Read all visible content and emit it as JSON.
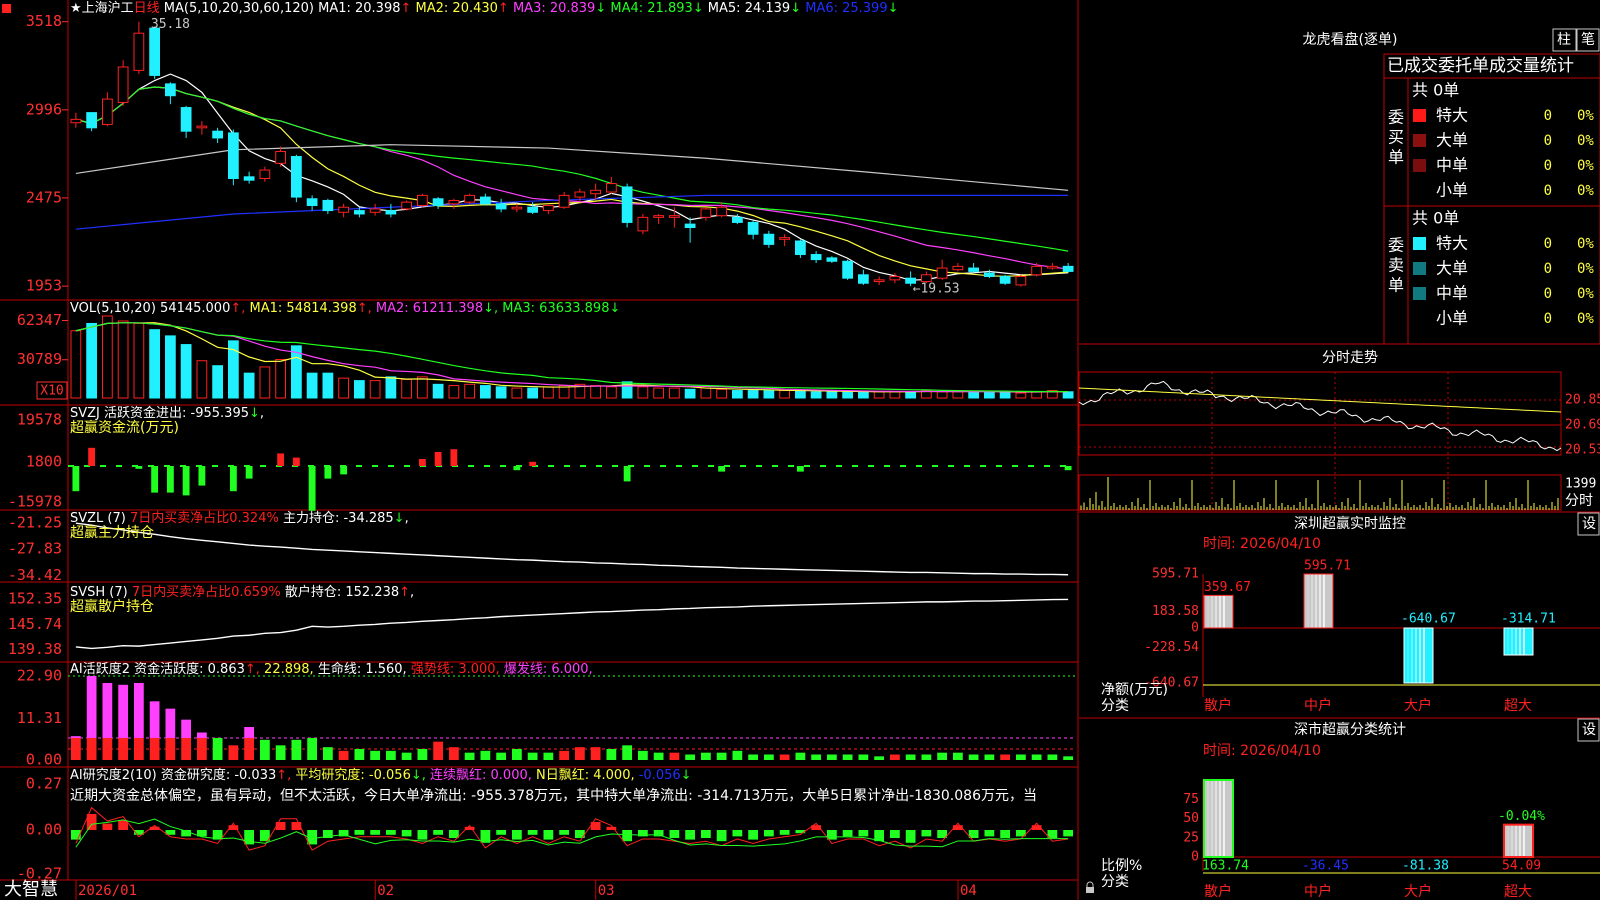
{
  "colors": {
    "up": "#ff2020",
    "down": "#20f0ff",
    "border": "#c00000",
    "yellow": "#ffff40",
    "magenta": "#ff40ff",
    "green": "#20ff20",
    "white": "#ffffff",
    "gray": "#c8c8c8",
    "blue": "#2030ff",
    "axisRed": "#ff3030"
  },
  "chart_header": {
    "menu_icon": "square-menu-icon",
    "title": "★上海沪工",
    "period": "日线",
    "ma_label": "MA(5,10,20,30,60,120)",
    "ma1": "MA1: 20.398",
    "ma1_arrow": "↑",
    "ma2": "MA2: 20.430",
    "ma2_arrow": "↑",
    "ma3": "MA3: 20.839",
    "ma3_arrow": "↓",
    "ma4": "MA4: 21.893",
    "ma4_arrow": "↓",
    "ma5": "MA5: 24.139",
    "ma5_arrow": "↓",
    "ma6": "MA6: 25.399",
    "ma6_arrow": "↓"
  },
  "price_panel": {
    "y_ticks": [
      "3518",
      "2996",
      "2475",
      "1953"
    ],
    "high_label": "35.18",
    "low_label": "←19.53",
    "candles": [
      [
        29.2,
        29.8,
        28.9,
        29.4
      ],
      [
        29.8,
        29.6,
        28.7,
        28.9
      ],
      [
        29.1,
        31.0,
        29.0,
        30.6
      ],
      [
        30.4,
        32.9,
        30.2,
        32.5
      ],
      [
        32.3,
        35.18,
        32.1,
        34.5
      ],
      [
        34.8,
        34.9,
        31.8,
        32.0
      ],
      [
        31.5,
        31.6,
        30.3,
        30.8
      ],
      [
        30.1,
        30.2,
        28.3,
        28.7
      ],
      [
        28.9,
        29.3,
        28.5,
        29.0
      ],
      [
        28.7,
        28.9,
        28.0,
        28.3
      ],
      [
        28.6,
        28.8,
        25.5,
        25.9
      ],
      [
        26.0,
        26.3,
        25.6,
        25.8
      ],
      [
        25.9,
        26.6,
        25.7,
        26.4
      ],
      [
        26.8,
        27.8,
        26.6,
        27.5
      ],
      [
        27.2,
        27.3,
        24.5,
        24.8
      ],
      [
        24.7,
        24.9,
        24.0,
        24.3
      ],
      [
        24.6,
        24.7,
        23.8,
        24.0
      ],
      [
        23.9,
        24.4,
        23.6,
        24.2
      ],
      [
        24.0,
        24.2,
        23.6,
        23.8
      ],
      [
        23.9,
        24.4,
        23.7,
        24.1
      ],
      [
        24.0,
        24.4,
        23.6,
        23.8
      ],
      [
        24.1,
        24.6,
        24.0,
        24.5
      ],
      [
        24.3,
        25.0,
        24.2,
        24.9
      ],
      [
        24.7,
        24.8,
        24.1,
        24.3
      ],
      [
        24.4,
        24.7,
        24.1,
        24.6
      ],
      [
        24.5,
        25.0,
        24.4,
        24.9
      ],
      [
        24.8,
        25.0,
        24.3,
        24.4
      ],
      [
        24.4,
        24.7,
        23.9,
        24.1
      ],
      [
        24.1,
        24.4,
        23.9,
        24.2
      ],
      [
        24.2,
        24.5,
        23.8,
        23.9
      ],
      [
        24.0,
        24.4,
        23.8,
        24.3
      ],
      [
        24.2,
        25.1,
        24.1,
        24.9
      ],
      [
        24.8,
        25.3,
        24.5,
        25.1
      ],
      [
        25.0,
        25.6,
        24.6,
        25.2
      ],
      [
        25.1,
        26.0,
        25.0,
        25.6
      ],
      [
        25.4,
        25.6,
        23.0,
        23.3
      ],
      [
        22.8,
        23.8,
        22.6,
        23.6
      ],
      [
        23.6,
        23.8,
        23.2,
        23.7
      ],
      [
        23.6,
        24.2,
        23.0,
        23.7
      ],
      [
        23.2,
        23.6,
        22.1,
        23.0
      ],
      [
        23.6,
        24.2,
        23.4,
        24.1
      ],
      [
        23.7,
        24.5,
        23.6,
        24.2
      ],
      [
        23.6,
        23.8,
        23.2,
        23.3
      ],
      [
        23.3,
        23.4,
        22.3,
        22.6
      ],
      [
        22.6,
        22.8,
        21.8,
        22.0
      ],
      [
        22.3,
        22.6,
        21.9,
        22.4
      ],
      [
        22.2,
        22.3,
        21.2,
        21.4
      ],
      [
        21.4,
        21.6,
        20.9,
        21.1
      ],
      [
        21.2,
        21.3,
        20.9,
        21.0
      ],
      [
        21.0,
        21.1,
        19.9,
        20.0
      ],
      [
        20.2,
        20.5,
        19.6,
        19.7
      ],
      [
        19.8,
        20.1,
        19.6,
        19.9
      ],
      [
        19.9,
        20.3,
        19.7,
        20.1
      ],
      [
        20.0,
        20.4,
        19.53,
        19.7
      ],
      [
        19.8,
        20.4,
        19.7,
        20.2
      ],
      [
        20.0,
        21.1,
        19.9,
        20.6
      ],
      [
        20.5,
        20.9,
        20.4,
        20.7
      ],
      [
        20.6,
        20.9,
        20.3,
        20.4
      ],
      [
        20.3,
        20.5,
        20.0,
        20.1
      ],
      [
        20.1,
        20.2,
        19.6,
        19.7
      ],
      [
        19.6,
        20.2,
        19.5,
        20.1
      ],
      [
        20.2,
        20.9,
        20.1,
        20.7
      ],
      [
        20.6,
        20.9,
        20.5,
        20.7
      ],
      [
        20.7,
        20.9,
        20.3,
        20.4
      ]
    ]
  },
  "vol_panel": {
    "header": "VOL(5,10,20)",
    "v": "54145.000",
    "v_arrow": "↑",
    "ma1": "MA1: 54814.398",
    "ma1_arrow": "↑",
    "ma2": "MA2: 61211.398",
    "ma2_arrow": "↓",
    "ma3": "MA3: 63633.898",
    "ma3_arrow": "↓",
    "y_ticks": [
      "62347",
      "30789"
    ],
    "unit_label": "X10",
    "values": [
      54145,
      60000,
      66000,
      62000,
      60000,
      55000,
      50000,
      43000,
      30000,
      26000,
      46000,
      20000,
      25000,
      31000,
      42000,
      20000,
      20000,
      16000,
      14000,
      14000,
      17000,
      15000,
      17000,
      11000,
      10000,
      11000,
      10000,
      9000,
      8000,
      8000,
      9000,
      10000,
      11000,
      10000,
      9000,
      13000,
      9000,
      8000,
      8000,
      7000,
      8000,
      7000,
      6000,
      6000,
      6000,
      6000,
      6000,
      5000,
      5000,
      5000,
      5000,
      5000,
      5000,
      5000,
      6000,
      5000,
      5000,
      5000,
      5000,
      5000,
      4000,
      5000,
      6000,
      5000
    ]
  },
  "svzj_panel": {
    "header": "SVZJ",
    "item1": "活跃资金进出: -955.395",
    "item1_arrow": "↓",
    "comma": ",",
    "sub": "超赢资金流(万元)",
    "y_ticks": [
      "19578",
      "1800",
      "-15978"
    ],
    "values": [
      -1.8,
      1.3,
      0,
      0,
      -0.2,
      -1.9,
      -1.9,
      -2.1,
      -1.4,
      0,
      -1.8,
      -0.9,
      0,
      0.9,
      0.6,
      -3.2,
      -0.9,
      -0.6,
      0,
      0,
      0,
      0,
      0.5,
      1.0,
      1.2,
      0,
      0,
      0,
      -0.3,
      0.3,
      0,
      0,
      0,
      0,
      0,
      -1.1,
      0,
      0,
      0,
      0,
      0,
      -0.4,
      0,
      0,
      0,
      0,
      -0.4,
      0,
      0,
      0,
      0,
      0,
      0,
      0,
      0,
      0,
      0,
      0,
      0,
      0,
      0,
      0,
      0,
      -0.3
    ]
  },
  "svzl_panel": {
    "header": "SVZL (7)",
    "item1": "7日内买卖净占比0.324%",
    "item2": "主力持仓: -34.285",
    "item2_arrow": "↓",
    "comma": ",",
    "sub": "超赢主力持仓",
    "y_ticks": [
      "-21.25",
      "-27.83",
      "-34.42"
    ],
    "values": [
      -21.3,
      -21.8,
      -22.5,
      -23.0,
      -23.6,
      -24.1,
      -24.7,
      -25.2,
      -25.6,
      -26.0,
      -26.4,
      -26.8,
      -27.1,
      -27.3,
      -27.6,
      -27.9,
      -28.1,
      -28.3,
      -28.5,
      -28.7,
      -28.9,
      -29.1,
      -29.3,
      -29.5,
      -29.7,
      -29.9,
      -30.1,
      -30.3,
      -30.5,
      -30.6,
      -30.8,
      -31.0,
      -31.1,
      -31.3,
      -31.4,
      -31.6,
      -31.7,
      -31.9,
      -32.0,
      -32.2,
      -32.3,
      -32.4,
      -32.6,
      -32.7,
      -32.8,
      -32.9,
      -33.0,
      -33.1,
      -33.2,
      -33.3,
      -33.4,
      -33.5,
      -33.6,
      -33.7,
      -33.7,
      -33.8,
      -33.9,
      -34.0,
      -34.0,
      -34.1,
      -34.1,
      -34.2,
      -34.2,
      -34.285
    ]
  },
  "svsh_panel": {
    "header": "SVSH (7)",
    "item1": "7日内买卖净占比0.659%",
    "item2": "散户持仓: 152.238",
    "item2_arrow": "↑",
    "comma": ",",
    "sub": "超赢散户持仓",
    "y_ticks": [
      "152.35",
      "145.74",
      "139.38"
    ],
    "values": [
      140.0,
      139.6,
      139.9,
      140.3,
      140.2,
      140.6,
      141.0,
      141.4,
      141.8,
      142.2,
      142.8,
      143.0,
      143.5,
      143.7,
      144.3,
      145.3,
      145.1,
      145.3,
      145.6,
      145.8,
      146.1,
      146.3,
      146.6,
      146.8,
      147.0,
      147.3,
      147.5,
      147.8,
      148.0,
      148.2,
      148.4,
      148.6,
      148.8,
      149.0,
      149.1,
      149.3,
      149.5,
      149.6,
      149.8,
      149.9,
      150.1,
      150.2,
      150.3,
      150.5,
      150.6,
      150.7,
      150.8,
      150.9,
      151.0,
      151.1,
      151.2,
      151.3,
      151.4,
      151.5,
      151.6,
      151.6,
      151.7,
      151.8,
      151.8,
      151.9,
      152.0,
      152.1,
      152.2,
      152.238
    ]
  },
  "ai_panel": {
    "header": "AI活跃度2",
    "item1": "资金活跃度: 0.863",
    "item1_arrow": "↑",
    "item2": "22.898",
    "item3": "生命线: 1.560",
    "item4": "强势线: 3.000",
    "item5": "爆发线: 6.000",
    "comma": ",",
    "y_ticks": [
      "22.90",
      "11.31",
      "0.00"
    ],
    "values": [
      6.5,
      22.9,
      21.0,
      20.5,
      21.0,
      16.0,
      14.0,
      11.0,
      7.5,
      6.0,
      4.0,
      9.0,
      5.5,
      4.0,
      5.5,
      6.0,
      3.5,
      2.5,
      3.0,
      2.5,
      2.5,
      2.0,
      3.0,
      5.0,
      3.5,
      2.0,
      2.5,
      2.0,
      3.0,
      2.0,
      2.0,
      2.5,
      3.5,
      3.5,
      3.0,
      4.0,
      2.5,
      2.0,
      2.0,
      1.5,
      2.0,
      2.0,
      2.5,
      1.5,
      1.5,
      1.5,
      2.0,
      1.5,
      1.5,
      1.5,
      1.5,
      1.0,
      1.5,
      1.5,
      1.5,
      2.0,
      2.0,
      1.5,
      1.5,
      1.5,
      1.5,
      1.5,
      1.5,
      1.0
    ]
  },
  "research_panel": {
    "header": "AI研究度2(10)",
    "item1": "资金研究度: -0.033",
    "item1_arrow": "↑",
    "item2": "平均研究度: -0.056",
    "item2_arrow": "↓",
    "item3": "连续飘红: 0.000",
    "item4": "N日飘红: 4.000",
    "item5": "-0.056",
    "item5_arrow": "↓",
    "comma": ",",
    "summary": "近期大资金总体偏空，虽有异动，但不太活跃，今日大单净流出: -955.378万元，其中特大单净流出: -314.713万元，大单5日累计净出-1830.086万元，当",
    "y_ticks": [
      "0.27",
      "0.00",
      "-0.27"
    ],
    "values": [
      -0.06,
      0.1,
      0.04,
      0.06,
      -0.03,
      0.02,
      -0.03,
      -0.04,
      -0.04,
      -0.06,
      0.03,
      -0.09,
      -0.07,
      0.05,
      0.05,
      -0.09,
      -0.05,
      -0.04,
      -0.03,
      -0.03,
      -0.03,
      -0.04,
      -0.06,
      -0.03,
      -0.05,
      0.02,
      -0.08,
      -0.03,
      -0.06,
      -0.03,
      -0.06,
      -0.03,
      -0.05,
      0.05,
      0.02,
      -0.07,
      -0.04,
      -0.04,
      -0.05,
      -0.06,
      -0.05,
      -0.07,
      -0.04,
      -0.06,
      -0.04,
      -0.03,
      -0.02,
      0.03,
      -0.06,
      -0.04,
      -0.04,
      -0.07,
      -0.05,
      -0.08,
      -0.04,
      -0.05,
      0.03,
      -0.05,
      -0.04,
      -0.05,
      -0.04,
      0.03,
      -0.05,
      -0.04
    ]
  },
  "x_axis": {
    "labels": [
      "2026/01",
      "02",
      "03",
      "04"
    ],
    "positions": [
      0,
      19,
      33,
      56
    ]
  },
  "footer_brand": "大智慧",
  "lock_icon": "lock-icon",
  "dragon_tiger": {
    "title": "龙虎看盘(逐单)",
    "btn_bar": "柱",
    "btn_pen": "笔",
    "col_header": "已成交委托单成交量统计",
    "buy_label": "委\n买\n单",
    "sell_label": "委\n卖\n单",
    "buy_total": "共 0单",
    "sell_total": "共 0单",
    "buy_rows": [
      {
        "name": "特大",
        "v": "0",
        "p": "0%"
      },
      {
        "name": "大单",
        "v": "0",
        "p": "0%"
      },
      {
        "name": "中单",
        "v": "0",
        "p": "0%"
      },
      {
        "name": "小单",
        "v": "0",
        "p": "0%"
      }
    ],
    "sell_rows": [
      {
        "name": "特大",
        "v": "0",
        "p": "0%"
      },
      {
        "name": "大单",
        "v": "0",
        "p": "0%"
      },
      {
        "name": "中单",
        "v": "0",
        "p": "0%"
      },
      {
        "name": "小单",
        "v": "0",
        "p": "0%"
      }
    ]
  },
  "intraday": {
    "title": "分时走势",
    "y_ticks": [
      "20.85",
      "20.69",
      "20.53"
    ],
    "vol_label": "1399",
    "vol_unit": "分时"
  },
  "sz_monitor": {
    "title": "深圳超赢实时监控",
    "settings": "设",
    "time": "时间: 2026/04/10",
    "y_ticks": [
      "595.71",
      "183.58",
      "0",
      "-228.54",
      "-640.67"
    ],
    "ylabel": "净额(万元)",
    "xlabel_left": "分类",
    "categories": [
      "散户",
      "中户",
      "大户",
      "超大"
    ],
    "values": [
      359.67,
      595.71,
      -640.67,
      -314.71
    ],
    "value_labels": [
      "359.67",
      "595.71",
      "-640.67",
      "-314.71"
    ]
  },
  "sz_classify": {
    "title": "深市超赢分类统计",
    "settings": "设",
    "time": "时间: 2026/04/10",
    "y_ticks": [
      "75",
      "50",
      "25",
      "0"
    ],
    "ylabel": "比例%",
    "xlabel_left": "分类",
    "categories": [
      "散户",
      "中户",
      "大户",
      "超大"
    ],
    "bars": [
      100,
      0,
      0,
      42
    ],
    "bar_label": "-0.04%",
    "values": [
      "163.74",
      "-36.45",
      "-81.38",
      "54.09"
    ]
  },
  "chart_data": [
    {
      "type": "candlestick",
      "title": "★上海沪工",
      "xlabel": "",
      "ylabel": "",
      "ylim": [
        19.5,
        35.2
      ],
      "series": [
        {
          "name": "K"
        }
      ]
    },
    {
      "type": "bar",
      "title": "深圳超赢实时监控",
      "categories": [
        "散户",
        "中户",
        "大户",
        "超大"
      ],
      "values": [
        359.67,
        595.71,
        -640.67,
        -314.71
      ],
      "ylabel": "净额(万元)",
      "ylim": [
        -640.67,
        595.71
      ]
    },
    {
      "type": "bar",
      "title": "深市超赢分类统计",
      "categories": [
        "散户",
        "中户",
        "大户",
        "超大"
      ],
      "values": [
        163.74,
        -36.45,
        -81.38,
        54.09
      ],
      "ylabel": "比例%"
    }
  ]
}
